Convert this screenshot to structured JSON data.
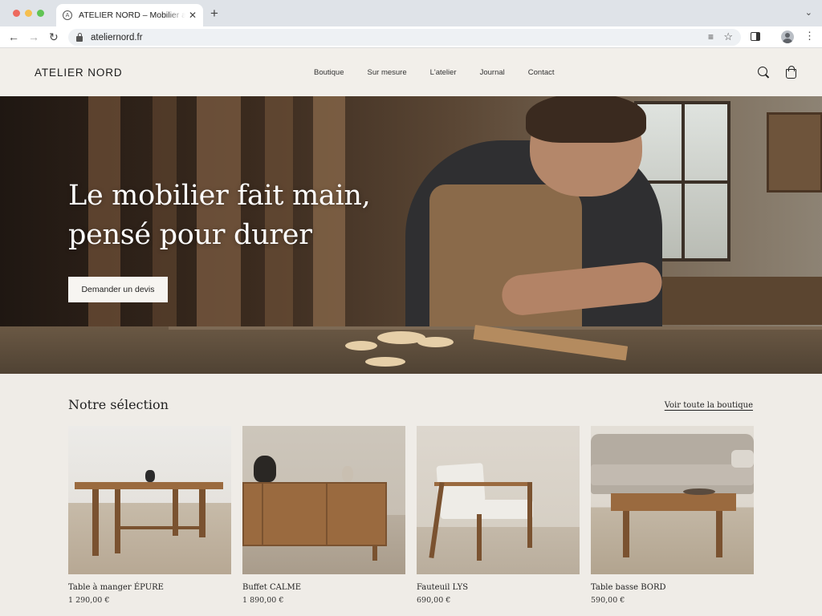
{
  "browser": {
    "tab_title": "ATELIER NORD – Mobilier artisanal",
    "url": "ateliernord.fr",
    "new_tab": "+",
    "close": "✕"
  },
  "header": {
    "logo": "ATELIER NORD",
    "nav": [
      "Boutique",
      "Sur mesure",
      "L'atelier",
      "Journal",
      "Contact"
    ]
  },
  "hero": {
    "title_line1": "Le mobilier fait main,",
    "title_line2": "pensé pour durer",
    "cta": "Demander un devis"
  },
  "selection": {
    "title": "Notre sélection",
    "see_all": "Voir toute la boutique",
    "products": [
      {
        "name": "Table à manger ÉPURE",
        "price": "1 290,00 €"
      },
      {
        "name": "Buffet CALME",
        "price": "1 890,00 €"
      },
      {
        "name": "Fauteuil LYS",
        "price": "690,00 €"
      },
      {
        "name": "Table basse BORD",
        "price": "590,00 €"
      }
    ]
  }
}
